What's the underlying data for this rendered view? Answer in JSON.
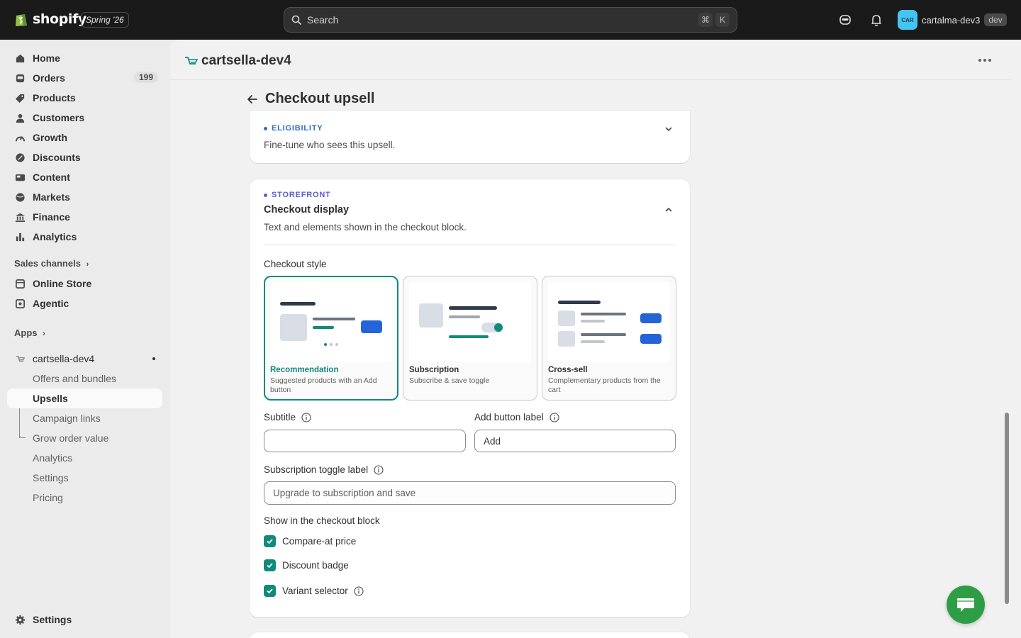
{
  "topbar": {
    "brand": "shopify",
    "edition": "Spring '26",
    "search_placeholder": "Search",
    "shortcut_cmd": "⌘",
    "shortcut_key": "K",
    "avatar_initials": "CAR",
    "store_name": "cartalma-dev3",
    "env_badge": "dev"
  },
  "sidebar": {
    "items": [
      {
        "label": "Home",
        "icon": "home-icon"
      },
      {
        "label": "Orders",
        "icon": "orders-icon",
        "count": "199"
      },
      {
        "label": "Products",
        "icon": "tag-icon"
      },
      {
        "label": "Customers",
        "icon": "person-icon"
      },
      {
        "label": "Growth",
        "icon": "growth-icon"
      },
      {
        "label": "Discounts",
        "icon": "discount-icon"
      },
      {
        "label": "Content",
        "icon": "content-icon"
      },
      {
        "label": "Markets",
        "icon": "globe-icon"
      },
      {
        "label": "Finance",
        "icon": "bank-icon"
      },
      {
        "label": "Analytics",
        "icon": "bar-chart-icon"
      }
    ],
    "sales_channels_heading": "Sales channels",
    "channels": [
      {
        "label": "Online Store",
        "icon": "store-icon"
      },
      {
        "label": "Agentic",
        "icon": "agentic-icon"
      }
    ],
    "apps_heading": "Apps",
    "app_name": "cartsella-dev4",
    "app_subitems": [
      {
        "label": "Offers and bundles"
      },
      {
        "label": "Upsells",
        "active": true
      },
      {
        "label": "Campaign links"
      },
      {
        "label": "Grow order value"
      },
      {
        "label": "Analytics"
      },
      {
        "label": "Settings"
      },
      {
        "label": "Pricing"
      }
    ],
    "settings_label": "Settings"
  },
  "app_header": {
    "title": "cartsella-dev4"
  },
  "page": {
    "title": "Checkout upsell"
  },
  "eligibility": {
    "eyebrow": "ELIGIBILITY",
    "description": "Fine-tune who sees this upsell.",
    "accent": "#2c6ecb"
  },
  "storefront": {
    "eyebrow": "STOREFRONT",
    "title": "Checkout display",
    "description": "Text and elements shown in the checkout block.",
    "accent": "#5b5bd6",
    "checkout_style_label": "Checkout style",
    "styles": [
      {
        "name": "Recommendation",
        "description": "Suggested products with an Add button",
        "selected": true
      },
      {
        "name": "Subscription",
        "description": "Subscribe & save toggle",
        "selected": false
      },
      {
        "name": "Cross-sell",
        "description": "Complementary products from the cart",
        "selected": false
      }
    ],
    "subtitle_label": "Subtitle",
    "subtitle_value": "",
    "add_button_label": "Add button label",
    "add_button_value": "Add",
    "subscription_toggle_label": "Subscription toggle label",
    "subscription_toggle_placeholder": "Upgrade to subscription and save",
    "show_block_label": "Show in the checkout block",
    "checkboxes": [
      {
        "label": "Compare-at price",
        "checked": true
      },
      {
        "label": "Discount badge",
        "checked": true
      },
      {
        "label": "Variant selector",
        "checked": true,
        "info": true
      }
    ]
  },
  "colors": {
    "brand_teal": "#0f8a7b",
    "chat_green": "#2e9e46",
    "blue": "#2563d9"
  }
}
